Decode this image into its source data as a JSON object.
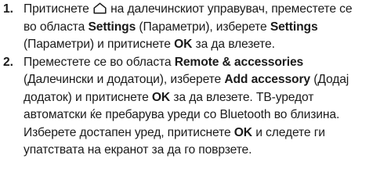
{
  "steps": [
    {
      "number": "1.",
      "parts": {
        "p1": "Притиснете ",
        "icon": "home-icon",
        "p2": " на далечинскиот управувач, преместете се во областа ",
        "b1": "Settings",
        "p3": " (Параметри), изберете ",
        "b2": "Settings",
        "p4": " (Параметри) и притиснете ",
        "b3": "OK",
        "p5": " за да влезете."
      }
    },
    {
      "number": "2.",
      "parts": {
        "p1": "Преместете се во областа ",
        "b1": "Remote & accessories",
        "p2": " (Далечински и додатоци), изберете ",
        "b2": "Add accessory",
        "p3": " (Додај додаток) и притиснете ",
        "b3": "OK",
        "p4": " за да влезете. ТВ-уредот автоматски ќе пребарува уреди со Bluetooth во близина. Изберете достапен уред, притиснете ",
        "b4": "OK",
        "p5": " и следете ги упатствата на екранот за да го поврзете."
      }
    }
  ]
}
